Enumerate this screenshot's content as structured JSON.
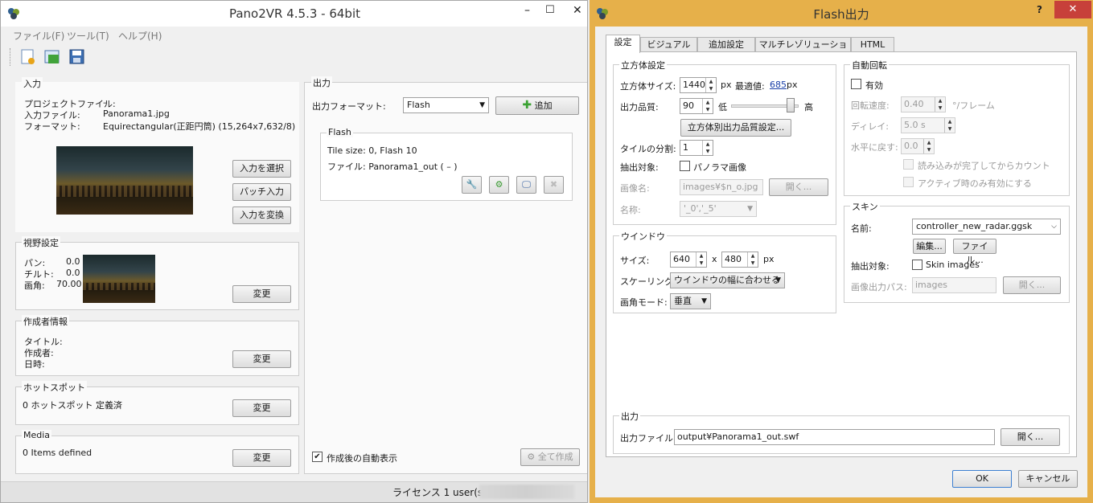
{
  "main": {
    "title": "Pano2VR 4.5.3 - 64bit",
    "min": "–",
    "max": "☐",
    "close": "✕",
    "menu": [
      "ファイル(F)",
      "ツール(T)",
      "ヘルプ(H)"
    ],
    "toolbar_icons": [
      "new-project-icon",
      "open-project-icon",
      "save-icon"
    ],
    "input": {
      "title": "入力",
      "project_label": "プロジェクトファイル:",
      "project_value": "–",
      "file_label": "入力ファイル:",
      "file_value": "Panorama1.jpg",
      "format_label": "フォーマット:",
      "format_value": "Equirectangular(正距円筒) (15,264x7,632/8)",
      "select_btn": "入力を選択",
      "patch_btn": "パッチ入力",
      "convert_btn": "入力を変換"
    },
    "view": {
      "title": "視野設定",
      "pan_label": "パン:",
      "pan_value": "0.0",
      "tilt_label": "チルト:",
      "tilt_value": "0.0",
      "fov_label": "画角:",
      "fov_value": "70.00",
      "change_btn": "変更"
    },
    "author": {
      "title": "作成者情報",
      "title_label": "タイトル:",
      "author_label": "作成者:",
      "date_label": "日時:",
      "change_btn": "変更"
    },
    "hotspot": {
      "title": "ホットスポット",
      "text": "0 ホットスポット 定義済",
      "change_btn": "変更"
    },
    "media": {
      "title": "Media",
      "text": "0 Items defined",
      "change_btn": "変更"
    },
    "output": {
      "title": "出力",
      "format_label": "出力フォーマット:",
      "format_value": "Flash",
      "add_btn": "追加",
      "flash_group": "Flash",
      "tile_info": "Tile size: 0, Flash 10",
      "file_info": "ファイル: Panorama1_out ( – )",
      "auto_show": "作成後の自動表示",
      "build_all": "全て作成"
    },
    "status": "ライセンス 1 user(s):"
  },
  "dialog": {
    "title": "Flash出力",
    "help": "?",
    "close": "✕",
    "tabs": [
      "設定",
      "ビジュアル",
      "追加設定",
      "マルチレゾリューション",
      "HTML"
    ],
    "cube": {
      "title": "立方体設定",
      "size_label": "立方体サイズ:",
      "size_value": "1440",
      "px": "px",
      "optimal_label": "最適値:",
      "optimal_value": "685",
      "px2": "px",
      "quality_label": "出力品質:",
      "quality_value": "90",
      "low": "低",
      "high": "高",
      "quality_level": 0.88,
      "per_face_btn": "立方体別出力品質設定...",
      "tile_split_label": "タイルの分割:",
      "tile_split_value": "1",
      "extract_label": "抽出対象:",
      "panorama_cb": "パノラマ画像",
      "image_name_label": "画像名:",
      "image_name_value": "images¥$n_o.jpg",
      "open_btn": "開く...",
      "name_label": "名称:",
      "name_value": "'_0','_5'"
    },
    "window": {
      "title": "ウインドウ",
      "size_label": "サイズ:",
      "width": "640",
      "x": "x",
      "height": "480",
      "px": "px",
      "scaling_label": "スケーリング:",
      "scaling_value": "ウインドウの幅に合わせる",
      "fov_mode_label": "画角モード:",
      "fov_mode_value": "垂直"
    },
    "autorotate": {
      "title": "自動回転",
      "enabled": "有効",
      "speed_label": "回転速度:",
      "speed_value": "0.40",
      "speed_unit": "°/フレーム",
      "delay_label": "ディレイ:",
      "delay_value": "5.0 s",
      "return_label": "水平に戻す:",
      "return_value": "0.0",
      "after_load": "読み込みが完了してからカウント",
      "active_only": "アクティブ時のみ有効にする"
    },
    "skin": {
      "title": "スキン",
      "name_label": "名前:",
      "name_value": "controller_new_radar.ggsk",
      "edit_btn": "編集...",
      "file_btn": "ファイル...",
      "extract_label": "抽出対象:",
      "skin_images": "Skin images",
      "path_label": "画像出力パス:",
      "path_value": "images",
      "open_btn": "開く..."
    },
    "output": {
      "title": "出力",
      "file_label": "出力ファイル:",
      "file_value": "output¥Panorama1_out.swf",
      "open_btn": "開く..."
    },
    "ok": "OK",
    "cancel": "キャンセル"
  }
}
